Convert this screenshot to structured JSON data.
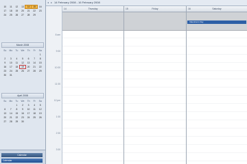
{
  "nav": {
    "months": [
      {
        "title": "",
        "weekdays": [],
        "rows": [
          [
            "",
            "",
            "",
            "",
            "",
            "",
            ""
          ],
          [
            "10",
            "11",
            "12",
            "13",
            "14",
            "15",
            "16"
          ],
          [
            "17",
            "18",
            "19",
            "20",
            "21",
            "22",
            "23"
          ],
          [
            "24",
            "25",
            "26",
            "27",
            "28",
            "29",
            ""
          ],
          [
            "",
            "",
            "",
            "",
            "",
            "",
            ""
          ]
        ],
        "highlighted": [
          "14",
          "15"
        ]
      },
      {
        "title": "March 2008",
        "weekdays": [
          "Su",
          "Mo",
          "Tu",
          "We",
          "Th",
          "Fr",
          "Sa"
        ],
        "rows": [
          [
            "",
            "",
            "",
            "",
            "",
            "",
            "1"
          ],
          [
            "2",
            "3",
            "4",
            "5",
            "6",
            "7",
            "8"
          ],
          [
            "9",
            "10",
            "11",
            "12",
            "13",
            "14",
            "15"
          ],
          [
            "16",
            "17",
            "18",
            "19",
            "20",
            "21",
            "22"
          ],
          [
            "23",
            "24",
            "25",
            "26",
            "27",
            "28",
            "29"
          ],
          [
            "30",
            "31",
            "",
            "",
            "",
            "",
            ""
          ]
        ],
        "today": "19"
      },
      {
        "title": "April 2008",
        "weekdays": [
          "Su",
          "Mo",
          "Tu",
          "We",
          "Th",
          "Fr",
          "Sa"
        ],
        "rows": [
          [
            "",
            "",
            "1",
            "2",
            "3",
            "4",
            "5"
          ],
          [
            "6",
            "7",
            "8",
            "9",
            "10",
            "11",
            "12"
          ],
          [
            "13",
            "14",
            "15",
            "16",
            "17",
            "18",
            "19"
          ],
          [
            "20",
            "21",
            "22",
            "23",
            "24",
            "25",
            "26"
          ],
          [
            "27",
            "28",
            "29",
            "30",
            "",
            "",
            ""
          ]
        ]
      }
    ],
    "section_tab": "Calendar",
    "calendar_button": "Calendar"
  },
  "header": {
    "arrows": "◂ ▸",
    "date_range": "14 February 2008 - 16 February 2008"
  },
  "times": [
    "8 am",
    "9 00",
    "10 00",
    "11 00",
    "12 pm",
    "1 00",
    "2 00",
    "3 00"
  ],
  "columns": [
    {
      "num": "14",
      "day": "Thursday"
    },
    {
      "num": "15",
      "day": "Friday"
    },
    {
      "num": "16",
      "day": "Saturday"
    }
  ],
  "event": {
    "label": "Valentine's Day"
  }
}
